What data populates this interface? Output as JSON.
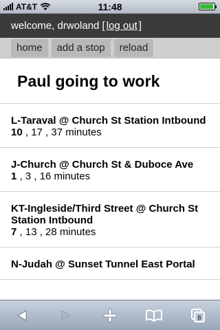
{
  "status_bar": {
    "carrier": "AT&T",
    "time": "11:48",
    "battery_level": 0.95
  },
  "header": {
    "welcome_prefix": "welcome, drwoland [",
    "logout_label": "log out",
    "welcome_suffix": "]"
  },
  "nav": {
    "home_label": "home",
    "add_stop_label": "add a stop",
    "reload_label": "reload"
  },
  "page_title": "Paul going to work",
  "stops": [
    {
      "name": "L-Taraval @ Church St Station Intbound",
      "first": "10",
      "rest": " , 17 , 37 minutes"
    },
    {
      "name": "J-Church @ Church St & Duboce Ave",
      "first": "1",
      "rest": " , 3 , 16 minutes"
    },
    {
      "name": "KT-Ingleside/Third Street @ Church St Station Intbound",
      "first": "7",
      "rest": " , 13 , 28 minutes"
    },
    {
      "name": "N-Judah @ Sunset Tunnel East Portal",
      "first": "",
      "rest": ""
    }
  ],
  "toolbar": {
    "tab_count": "8",
    "icons": [
      "back-arrow-icon",
      "forward-arrow-icon",
      "add-plus-icon",
      "bookmarks-book-icon",
      "pages-icon"
    ]
  }
}
